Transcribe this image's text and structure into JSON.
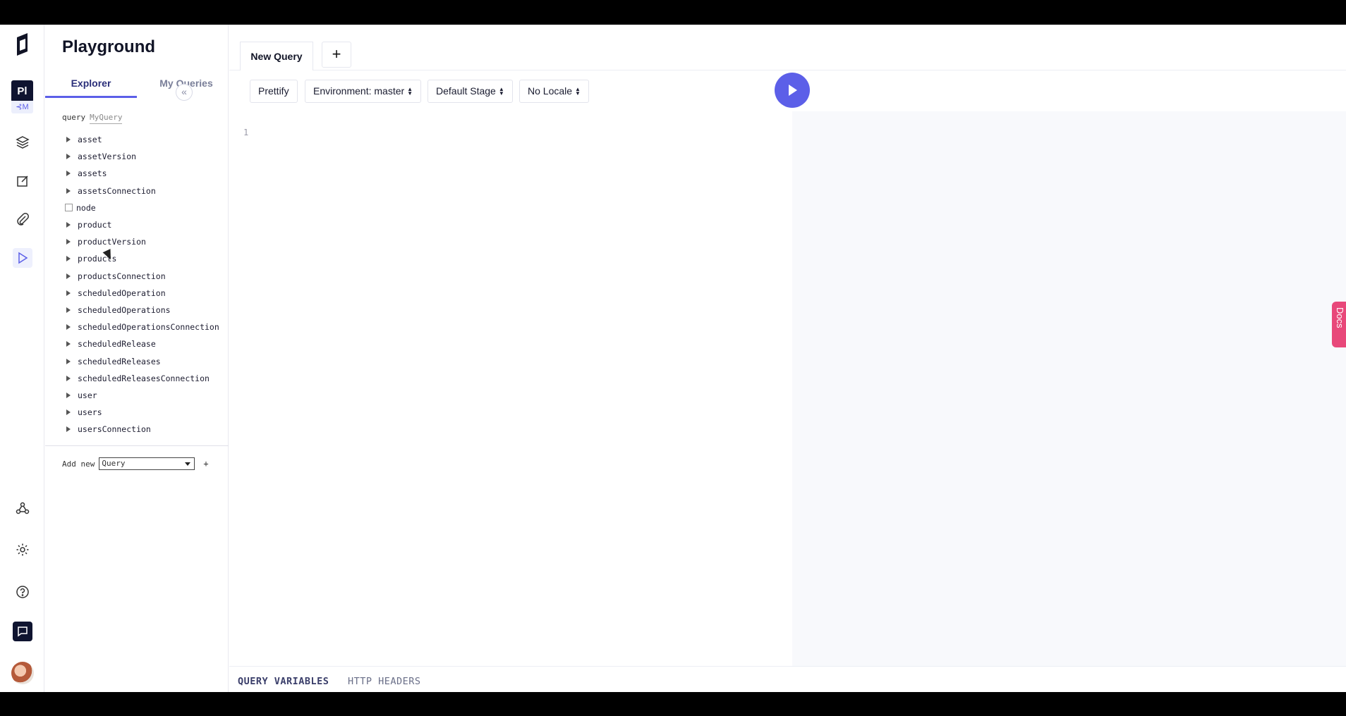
{
  "app": {
    "title": "Playground"
  },
  "rail": {
    "project_badge": "Pl",
    "project_sub": "⊰M",
    "icons": [
      "layers-icon",
      "edit-icon",
      "paperclip-icon",
      "play-icon",
      "webhook-icon",
      "gear-icon",
      "help-icon",
      "chat-icon"
    ]
  },
  "explorer": {
    "tabs": [
      "Explorer",
      "My Queries"
    ],
    "collapse_glyph": "«",
    "query_keyword": "query",
    "query_name": "MyQuery",
    "fields": [
      {
        "name": "asset",
        "type": "arrow"
      },
      {
        "name": "assetVersion",
        "type": "arrow"
      },
      {
        "name": "assets",
        "type": "arrow"
      },
      {
        "name": "assetsConnection",
        "type": "arrow"
      },
      {
        "name": "node",
        "type": "check"
      },
      {
        "name": "product",
        "type": "arrow"
      },
      {
        "name": "productVersion",
        "type": "arrow"
      },
      {
        "name": "products",
        "type": "arrow"
      },
      {
        "name": "productsConnection",
        "type": "arrow"
      },
      {
        "name": "scheduledOperation",
        "type": "arrow"
      },
      {
        "name": "scheduledOperations",
        "type": "arrow"
      },
      {
        "name": "scheduledOperationsConnection",
        "type": "arrow"
      },
      {
        "name": "scheduledRelease",
        "type": "arrow"
      },
      {
        "name": "scheduledReleases",
        "type": "arrow"
      },
      {
        "name": "scheduledReleasesConnection",
        "type": "arrow"
      },
      {
        "name": "user",
        "type": "arrow"
      },
      {
        "name": "users",
        "type": "arrow"
      },
      {
        "name": "usersConnection",
        "type": "arrow"
      }
    ],
    "add_new_label": "Add new",
    "add_new_value": "Query",
    "add_new_plus": "+"
  },
  "tabs": {
    "active_label": "New Query",
    "add_glyph": "+"
  },
  "toolbar": {
    "prettify": "Prettify",
    "environment": "Environment: master",
    "stage": "Default Stage",
    "locale": "No Locale",
    "updown": "▲▼"
  },
  "editor": {
    "line_number": "1"
  },
  "docs_label": "Docs",
  "bottom": {
    "variables": "QUERY VARIABLES",
    "headers": "HTTP HEADERS"
  },
  "colors": {
    "accent": "#5c5fe8",
    "dark": "#0f1430",
    "docs": "#e8487a"
  }
}
